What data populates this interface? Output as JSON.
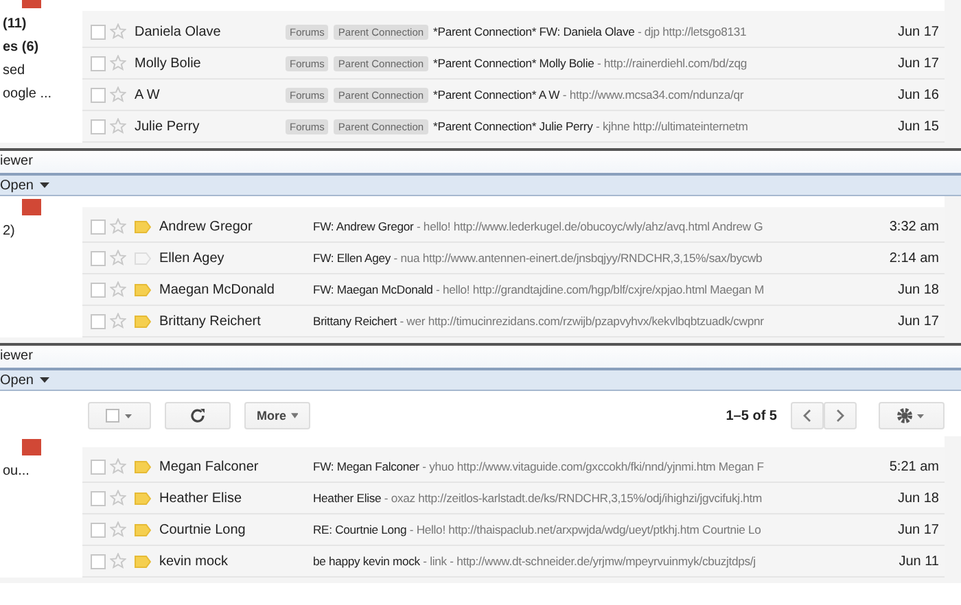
{
  "panes": [
    {
      "kind": "labelled",
      "sidebar": [
        {
          "text": "(11)",
          "bold": true
        },
        {
          "text": "es (6)",
          "bold": true
        },
        {
          "text": "sed",
          "bold": false
        },
        {
          "text": "oogle ...",
          "bold": false
        }
      ],
      "rows": [
        {
          "checked": false,
          "sender": "Daniela Olave",
          "labels": [
            "Forums",
            "Parent Connection"
          ],
          "subject": "*Parent Connection* FW: Daniela Olave",
          "snippet": "- djp http://letsgo8131",
          "date": "Jun 17"
        },
        {
          "checked": false,
          "sender": "Molly Bolie",
          "labels": [
            "Forums",
            "Parent Connection"
          ],
          "subject": "*Parent Connection* Molly Bolie",
          "snippet": "- http://rainerdiehl.com/bd/zqg",
          "date": "Jun 17"
        },
        {
          "checked": false,
          "sender": "A W",
          "labels": [
            "Forums",
            "Parent Connection"
          ],
          "subject": "*Parent Connection* A W",
          "snippet": "- http://www.mcsa34.com/ndunza/qr",
          "date": "Jun 16"
        },
        {
          "checked": false,
          "sender": "Julie Perry",
          "labels": [
            "Forums",
            "Parent Connection"
          ],
          "subject": "*Parent Connection* Julie Perry",
          "snippet": "- kjhne http://ultimateinternetm",
          "date": "Jun 15"
        }
      ]
    },
    {
      "kind": "viewer",
      "title": "iewer",
      "menu": "Open"
    },
    {
      "kind": "foldered",
      "sidebar": [
        {
          "text": "2)",
          "bold": false
        }
      ],
      "rows": [
        {
          "checked": false,
          "sender": "Andrew Gregor",
          "important": true,
          "subject": "FW: Andrew Gregor",
          "snippet": "- hello! http://www.lederkugel.de/obucoyc/wly/ahz/avq.html Andrew G",
          "date": "3:32 am"
        },
        {
          "checked": false,
          "sender": "Ellen Agey",
          "important": false,
          "subject": "FW: Ellen Agey",
          "snippet": "- nua http://www.antennen-einert.de/jnsbqjyy/RNDCHR,3,15%/sax/bycwb",
          "date": "2:14 am"
        },
        {
          "checked": false,
          "sender": "Maegan McDonald",
          "important": true,
          "subject": "FW: Maegan McDonald",
          "snippet": "- hello! http://grandtajdine.com/hgp/blf/cxjre/xpjao.html Maegan M",
          "date": "Jun 18"
        },
        {
          "checked": false,
          "sender": "Brittany Reichert",
          "important": true,
          "subject": "Brittany Reichert",
          "snippet": "- wer http://timucinrezidans.com/rzwijb/pzapvyhvx/kekvlbqbtzuadk/cwpnr",
          "date": "Jun 17"
        }
      ]
    },
    {
      "kind": "viewer",
      "title": "iewer",
      "menu": "Open"
    },
    {
      "kind": "toolbar",
      "more": "More",
      "range": "1–5 of 5"
    },
    {
      "kind": "foldered",
      "sidebar": [
        {
          "text": "ou...",
          "bold": false
        }
      ],
      "rows": [
        {
          "checked": false,
          "sender": "Megan Falconer",
          "important": true,
          "subject": "FW: Megan Falconer",
          "snippet": "- yhuo http://www.vitaguide.com/gxccokh/fki/nnd/yjnmi.htm Megan F",
          "date": "5:21 am"
        },
        {
          "checked": false,
          "sender": "Heather Elise",
          "important": true,
          "subject": "Heather Elise",
          "snippet": "- oxaz http://zeitlos-karlstadt.de/ks/RNDCHR,3,15%/odj/ihighzi/jgvcifukj.htm",
          "date": "Jun 18"
        },
        {
          "checked": false,
          "sender": "Courtnie Long",
          "important": true,
          "subject": "RE: Courtnie Long",
          "snippet": "- Hello! http://thaispaclub.net/arxpwjda/wdg/ueyt/ptkhj.htm Courtnie Lo",
          "date": "Jun 17"
        },
        {
          "checked": false,
          "sender": "kevin mock",
          "important": true,
          "subject": "be happy kevin mock",
          "snippet": "- link - http://www.dt-schneider.de/yrjmw/mpeyrvuinmyk/cbuzjtdps/j",
          "date": "Jun 11"
        }
      ]
    }
  ]
}
